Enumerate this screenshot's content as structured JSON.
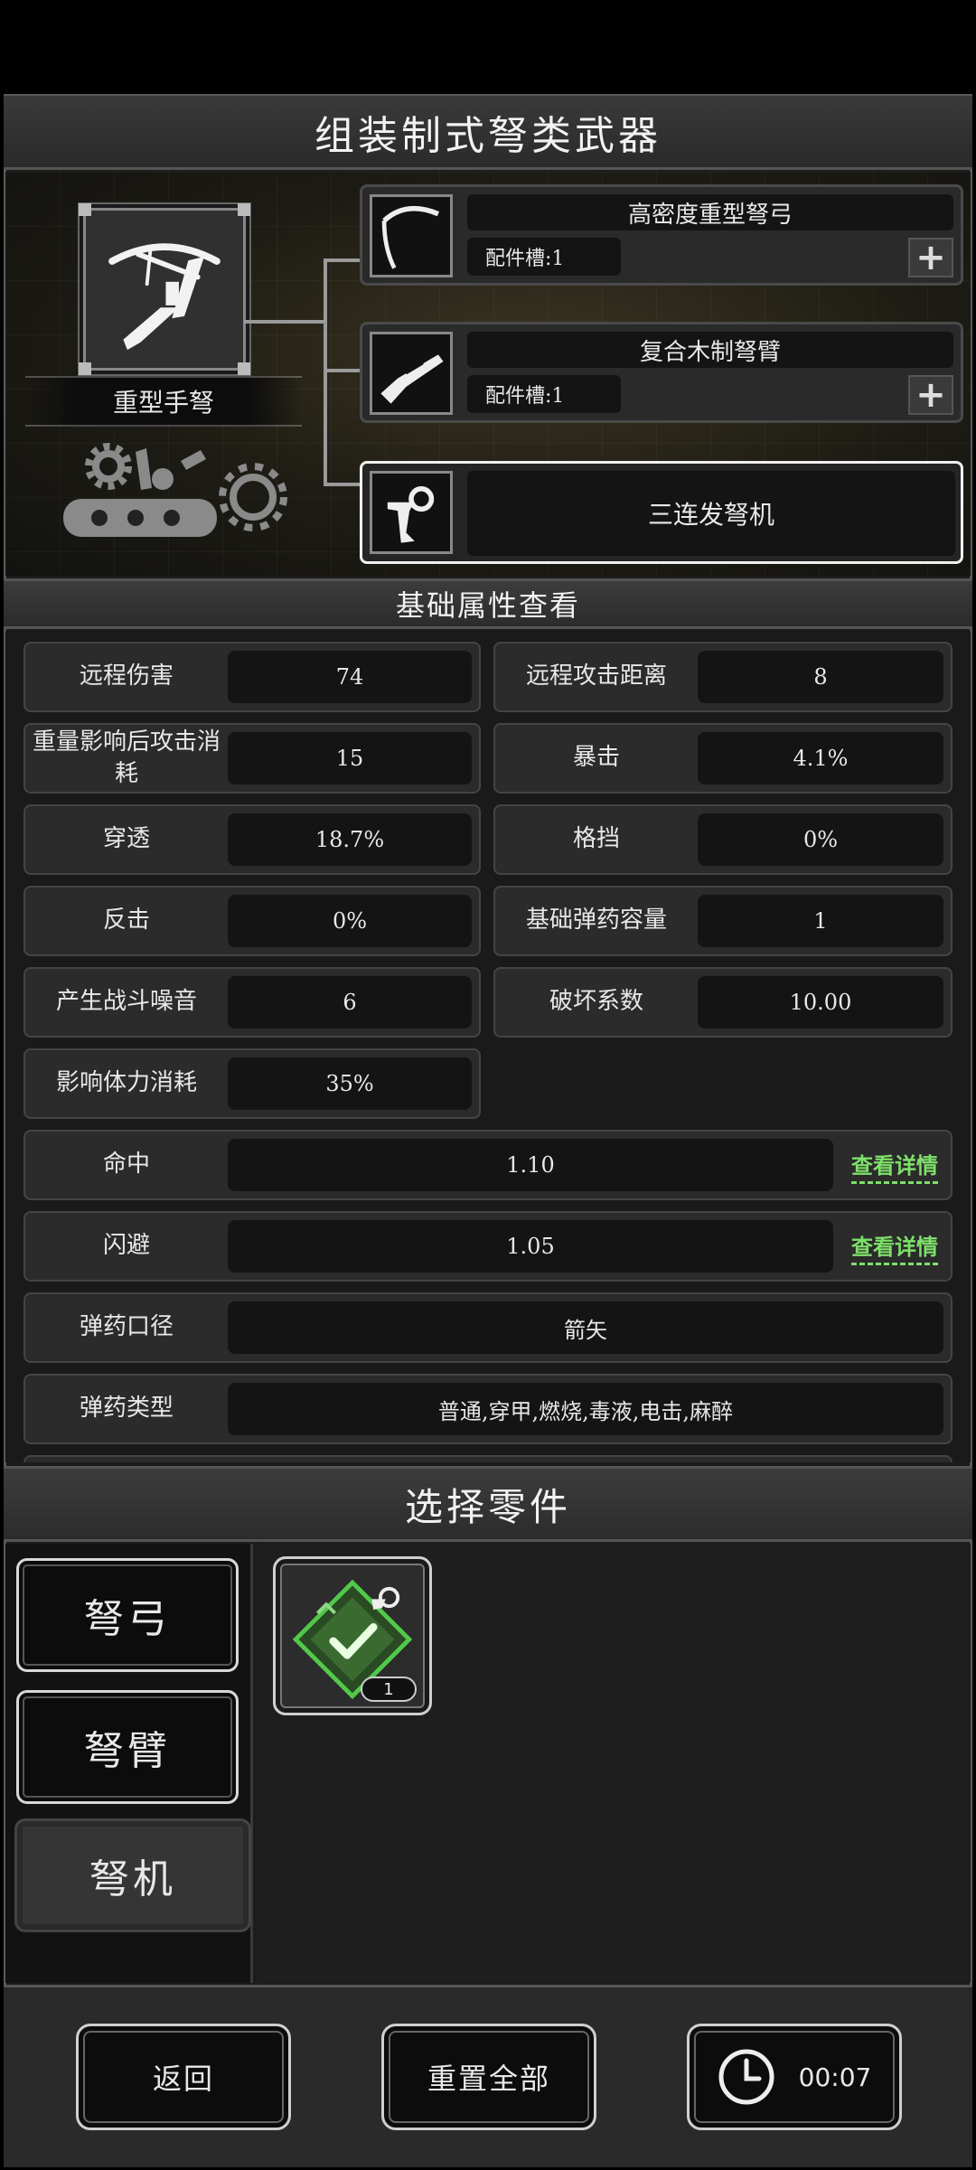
{
  "title": "组装制式弩类武器",
  "weapon": {
    "name": "重型手弩"
  },
  "parts": [
    {
      "name": "高密度重型弩弓",
      "slot_label": "配件槽:1",
      "add_icon": "plus-icon"
    },
    {
      "name": "复合木制弩臂",
      "slot_label": "配件槽:1",
      "add_icon": "plus-icon"
    },
    {
      "name": "三连发弩机"
    }
  ],
  "attributes_header": "基础属性查看",
  "stats": [
    {
      "label": "远程伤害",
      "value": "74"
    },
    {
      "label": "远程攻击距离",
      "value": "8"
    },
    {
      "label": "重量影响后攻击消耗",
      "value": "15"
    },
    {
      "label": "暴击",
      "value": "4.1%"
    },
    {
      "label": "穿透",
      "value": "18.7%"
    },
    {
      "label": "格挡",
      "value": "0%"
    },
    {
      "label": "反击",
      "value": "0%"
    },
    {
      "label": "基础弹药容量",
      "value": "1"
    },
    {
      "label": "产生战斗噪音",
      "value": "6"
    },
    {
      "label": "破坏系数",
      "value": "10.00"
    },
    {
      "label": "影响体力消耗",
      "value": "35%"
    }
  ],
  "wide_stats": [
    {
      "label": "命中",
      "value": "1.10",
      "link": "查看详情"
    },
    {
      "label": "闪避",
      "value": "1.05",
      "link": "查看详情"
    },
    {
      "label": "弹药口径",
      "value": "箭矢"
    },
    {
      "label": "弹药类型",
      "value": "普通,穿甲,燃烧,毒液,电击,麻醉"
    }
  ],
  "select_header": "选择零件",
  "tabs": [
    {
      "label": "弩弓",
      "active": false
    },
    {
      "label": "弩臂",
      "active": false
    },
    {
      "label": "弩机",
      "active": true
    }
  ],
  "part_items": [
    {
      "count": "1",
      "icon": "equipped-check-icon"
    }
  ],
  "buttons": {
    "back": "返回",
    "reset": "重置全部",
    "timer": "00:07"
  },
  "colors": {
    "link_green": "#7ee06a",
    "check_green": "#52c84a"
  }
}
